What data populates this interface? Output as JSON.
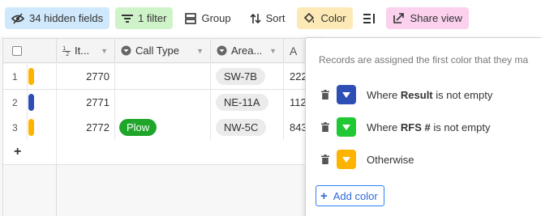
{
  "toolbar": {
    "hidden_fields_label": "34 hidden fields",
    "filter_label": "1 filter",
    "group_label": "Group",
    "sort_label": "Sort",
    "color_label": "Color",
    "share_label": "Share view"
  },
  "grid": {
    "columns": {
      "item": "It...",
      "call_type": "Call Type",
      "area": "Area...",
      "a_icon": "A"
    },
    "rows": [
      {
        "num": "1",
        "color": "#fcb400",
        "item": "2770",
        "call_type": "",
        "area": "SW-7B",
        "a": "222"
      },
      {
        "num": "2",
        "color": "#2d4fb5",
        "item": "2771",
        "call_type": "",
        "area": "NE-11A",
        "a": "112"
      },
      {
        "num": "3",
        "color": "#fcb400",
        "item": "2772",
        "call_type": "Plow",
        "area": "NW-5C",
        "a": "843"
      }
    ],
    "add_row": "+"
  },
  "color_popup": {
    "description": "Records are assigned the first color that they ma",
    "rules": [
      {
        "prefix": "Where ",
        "field": "Result",
        "suffix": " is not empty",
        "color": "#2d4fb5"
      },
      {
        "prefix": "Where ",
        "field": "RFS #",
        "suffix": " is not empty",
        "color": "#20c933"
      },
      {
        "prefix": "",
        "field": "",
        "suffix": "Otherwise",
        "color": "#fcb400"
      }
    ],
    "add_color_label": "Add color"
  }
}
